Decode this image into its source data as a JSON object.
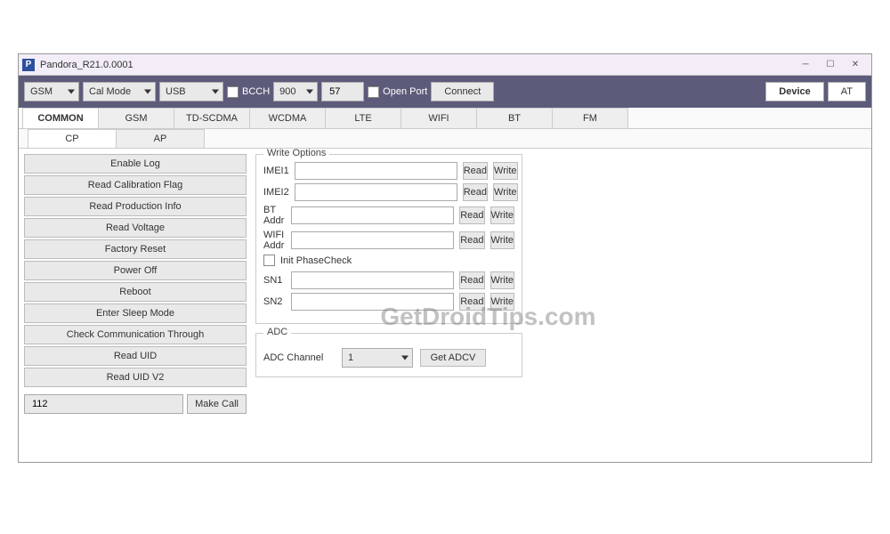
{
  "window": {
    "title": "Pandora_R21.0.0001",
    "icon_letter": "P"
  },
  "toolbar": {
    "combo_mode": "GSM",
    "combo_cal": "Cal Mode",
    "combo_conn": "USB",
    "bcch_label": "BCCH",
    "bcch_channel": "900",
    "bcch_value": "57",
    "open_port_label": "Open Port",
    "connect_label": "Connect",
    "device_label": "Device",
    "at_label": "AT"
  },
  "tabs": [
    "COMMON",
    "GSM",
    "TD-SCDMA",
    "WCDMA",
    "LTE",
    "WIFI",
    "BT",
    "FM"
  ],
  "active_tab": 0,
  "subtabs": [
    "CP",
    "AP"
  ],
  "active_subtab": 0,
  "left_buttons": [
    "Enable Log",
    "Read Calibration Flag",
    "Read Production Info",
    "Read Voltage",
    "Factory Reset",
    "Power Off",
    "Reboot",
    "Enter Sleep Mode",
    "Check Communication Through",
    "Read UID",
    "Read UID V2"
  ],
  "call": {
    "number": "112",
    "make_call_label": "Make Call"
  },
  "write_options": {
    "title": "Write Options",
    "rows1": [
      {
        "label": "IMEI1"
      },
      {
        "label": "IMEI2"
      },
      {
        "label": "BT Addr"
      },
      {
        "label": "WIFI Addr"
      }
    ],
    "init_phasecheck_label": "Init PhaseCheck",
    "rows2": [
      {
        "label": "SN1"
      },
      {
        "label": "SN2"
      }
    ],
    "read_label": "Read",
    "write_label": "Write"
  },
  "adc": {
    "title": "ADC",
    "channel_label": "ADC Channel",
    "channel_value": "1",
    "get_label": "Get ADCV"
  },
  "watermark": "GetDroidTips.com"
}
